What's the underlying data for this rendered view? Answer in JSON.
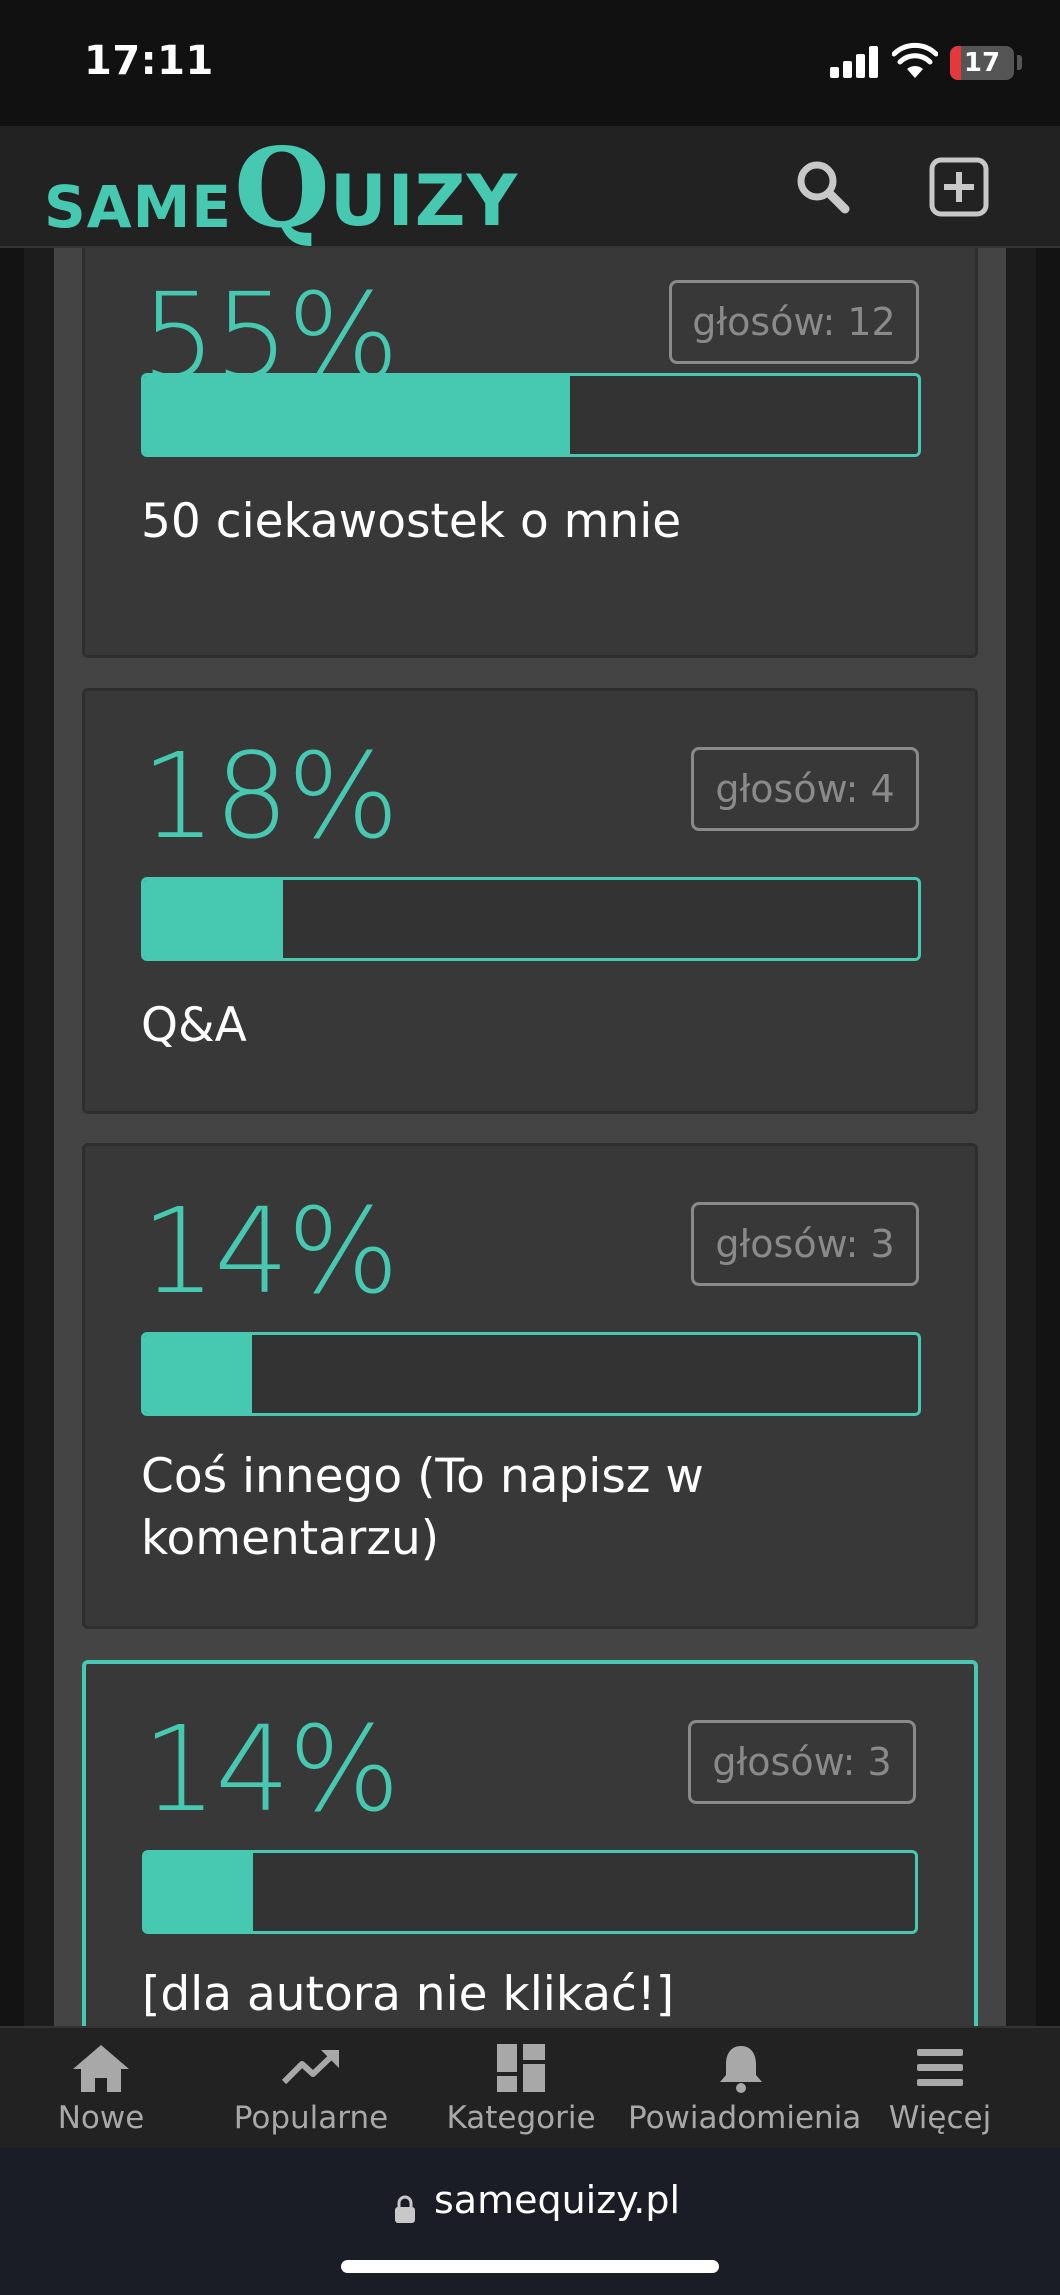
{
  "status_bar": {
    "time": "17:11",
    "battery": "17",
    "battery_level": 0.17
  },
  "header": {
    "logo": {
      "same": "SAME",
      "q": "Q",
      "uizy": "UIZY"
    },
    "search_icon": "search-icon",
    "add_icon": "plus-square-icon"
  },
  "poll_results": [
    {
      "percent": "55%",
      "fill": 0.55,
      "votes": "głosów: 12",
      "answer": "50 ciekawostek o mnie",
      "selected": false
    },
    {
      "percent": "18%",
      "fill": 0.18,
      "votes": "głosów: 4",
      "answer": "Q&A",
      "selected": false
    },
    {
      "percent": "14%",
      "fill": 0.14,
      "votes": "głosów: 3",
      "answer": "Coś innego (To napisz w komentarzu)",
      "selected": false
    },
    {
      "percent": "14%",
      "fill": 0.14,
      "votes": "głosów: 3",
      "answer": "[dla autora nie klikać!]",
      "selected": true
    }
  ],
  "bottom_nav": [
    {
      "label": "Nowe",
      "icon": "home-icon"
    },
    {
      "label": "Popularne",
      "icon": "trending-icon"
    },
    {
      "label": "Kategorie",
      "icon": "dashboard-icon"
    },
    {
      "label": "Powiadomienia",
      "icon": "bell-icon"
    },
    {
      "label": "Więcej",
      "icon": "menu-icon"
    }
  ],
  "browser": {
    "url": "samequizy.pl"
  },
  "colors": {
    "accent": "#46c9b0",
    "background": "#131313",
    "card": "#383838",
    "battery_low": "#e5383b"
  }
}
